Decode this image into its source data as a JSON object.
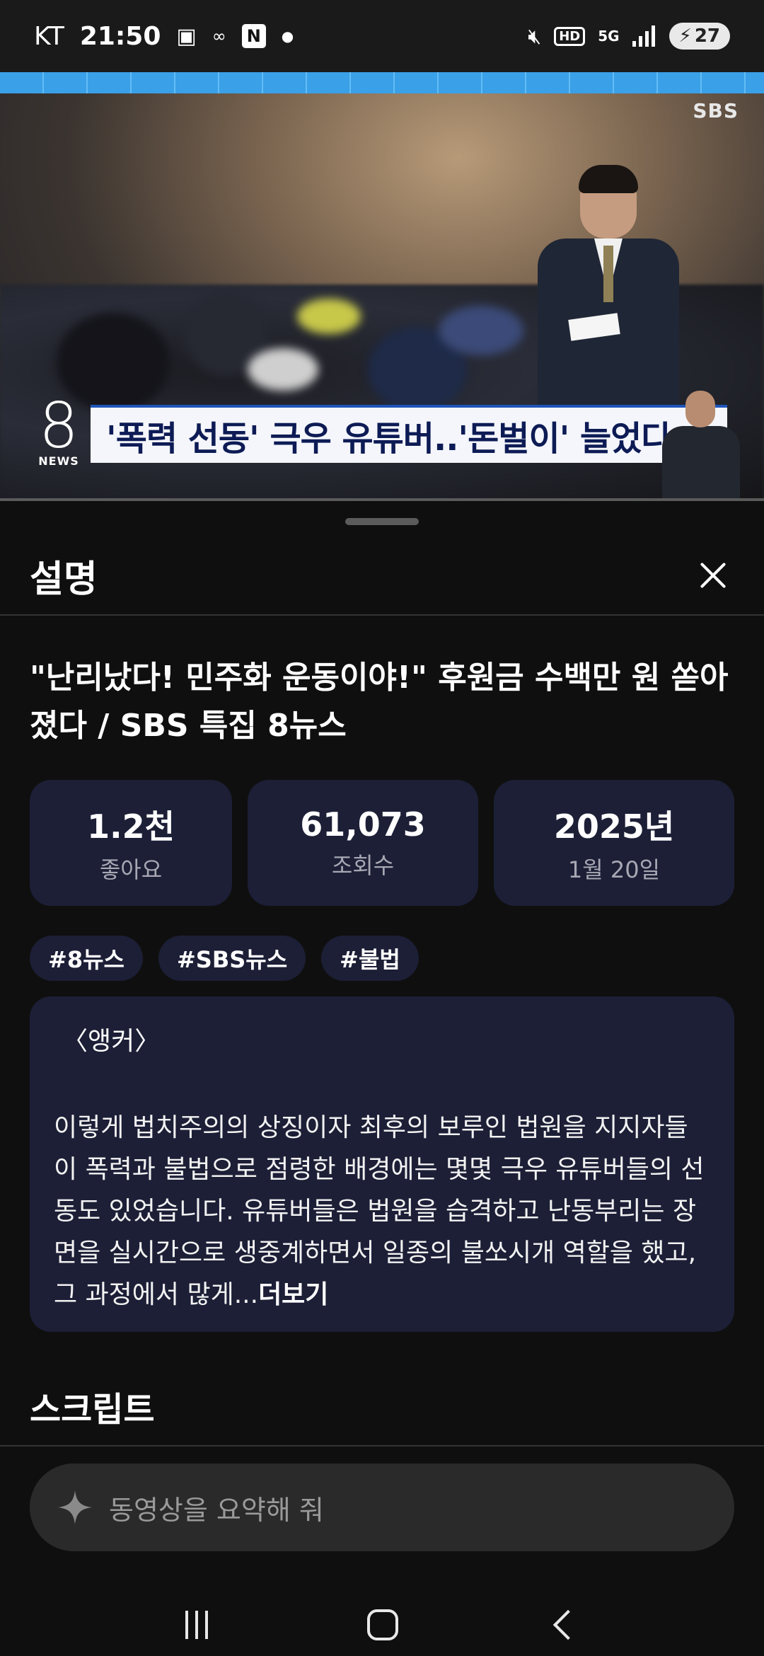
{
  "status_bar": {
    "carrier": "KT",
    "time": "21:50",
    "network_badge": "5G",
    "hd_badge": "HD",
    "battery": "27",
    "notification_letter": "N",
    "icons": [
      "screenshot-icon",
      "app-icon",
      "news-n-icon",
      "dot-icon",
      "mute-icon",
      "hd-icon",
      "5g-icon",
      "signal-icon",
      "battery-charging-icon"
    ]
  },
  "video": {
    "channel_logo": "SBS",
    "program_number": "8",
    "program_label": "NEWS",
    "caption": "'폭력 선동' 극우 유튜버..'돈벌이' 늘었다"
  },
  "sheet": {
    "title": "설명",
    "video_title": "\"난리났다! 민주화 운동이야!\" 후원금 수백만 원 쏟아졌다 / SBS 특집 8뉴스",
    "stats": [
      {
        "value": "1.2천",
        "label": "좋아요"
      },
      {
        "value": "61,073",
        "label": "조회수"
      },
      {
        "value": "2025년",
        "label": "1월 20일"
      }
    ],
    "tags": [
      "#8뉴스",
      "#SBS뉴스",
      "#불법"
    ],
    "description": {
      "anchor_label": "〈앵커〉",
      "text": "이렇게 법치주의의 상징이자 최후의 보루인 법원을 지지자들이 폭력과 불법으로 점령한 배경에는 몇몇 극우 유튜버들의 선동도 있었습니다. 유튜버들은 법원을 습격하고 난동부리는 장면을 실시간으로 생중계하면서 일종의 불쏘시개 역할을 했고, 그 과정에서 많게...",
      "more_label": "더보기"
    },
    "script_heading": "스크립트",
    "prompt_placeholder": "동영상을 요약해 줘"
  },
  "colors": {
    "background": "#0f0f0f",
    "card": "#1c1f36",
    "caption_text": "#0d1b55"
  }
}
